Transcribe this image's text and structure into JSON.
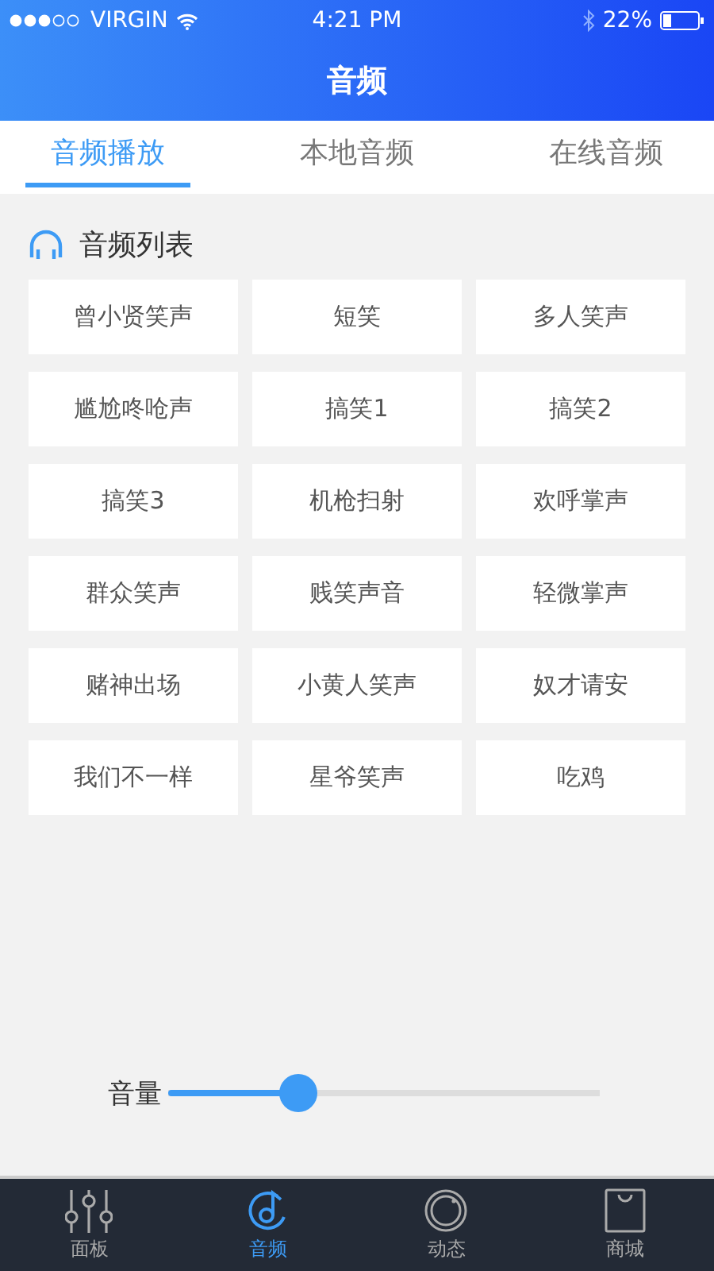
{
  "status_bar": {
    "carrier": "VIRGIN",
    "time": "4:21 PM",
    "battery": "22%"
  },
  "nav": {
    "title": "音频"
  },
  "tabs": [
    {
      "label": "音频播放",
      "selected": true
    },
    {
      "label": "本地音频",
      "selected": false
    },
    {
      "label": "在线音频",
      "selected": false
    }
  ],
  "section": {
    "title": "音频列表"
  },
  "sounds": [
    "曾小贤笑声",
    "短笑",
    "多人笑声",
    "尴尬咚呛声",
    "搞笑1",
    "搞笑2",
    "搞笑3",
    "机枪扫射",
    "欢呼掌声",
    "群众笑声",
    "贱笑声音",
    "轻微掌声",
    "赌神出场",
    "小黄人笑声",
    "奴才请安",
    "我们不一样",
    "星爷笑声",
    "吃鸡"
  ],
  "volume": {
    "label": "音量",
    "level": 0.3
  },
  "bottom_nav": [
    {
      "label": "面板",
      "kind": "sliders",
      "selected": false
    },
    {
      "label": "音频",
      "kind": "music",
      "selected": true
    },
    {
      "label": "动态",
      "kind": "circle",
      "selected": false
    },
    {
      "label": "商城",
      "kind": "bag",
      "selected": false
    }
  ]
}
